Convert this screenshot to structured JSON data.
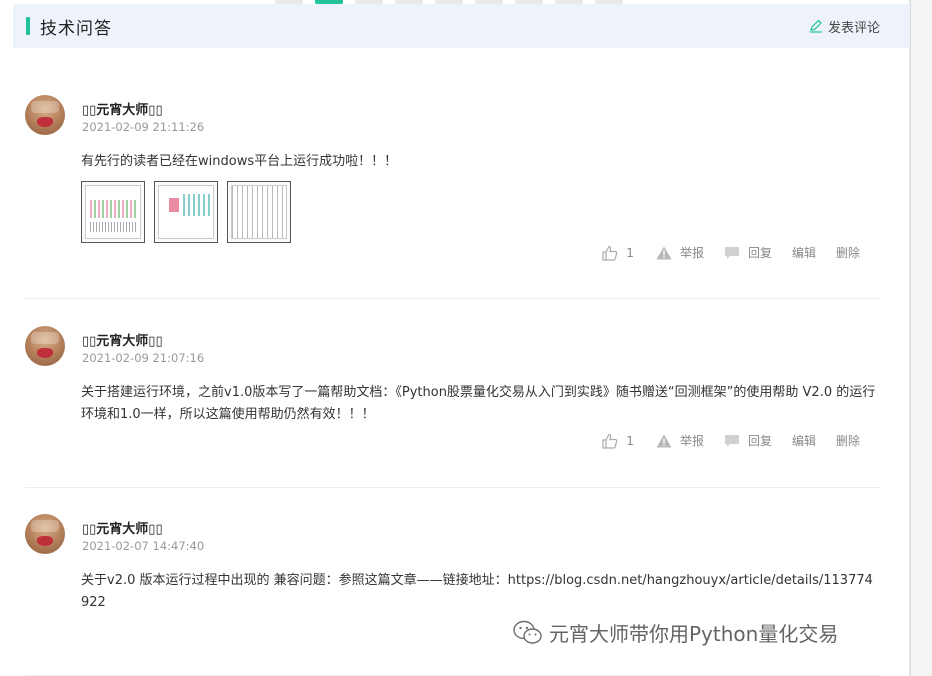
{
  "header": {
    "title": "技术问答",
    "post_label": "发表评论"
  },
  "comments": [
    {
      "username": "▯▯元宵大师▯▯",
      "time": "2021-02-09 21:11:26",
      "text": "有先行的读者已经在windows平台上运行成功啦！！！",
      "likes": "1",
      "report": "举报",
      "reply": "回复",
      "edit": "编辑",
      "delete": "删除"
    },
    {
      "username": "▯▯元宵大师▯▯",
      "time": "2021-02-09 21:07:16",
      "text": "关于搭建运行环境，之前v1.0版本写了一篇帮助文档：《Python股票量化交易从入门到实践》随书赠送“回测框架”的使用帮助 V2.0 的运行环境和1.0一样，所以这篇使用帮助仍然有效！！！",
      "likes": "1",
      "report": "举报",
      "reply": "回复",
      "edit": "编辑",
      "delete": "删除"
    },
    {
      "username": "▯▯元宵大师▯▯",
      "time": "2021-02-07 14:47:40",
      "text": "关于v2.0 版本运行过程中出现的 兼容问题：参照这篇文章——链接地址：https://blog.csdn.net/hangzhouyx/article/details/113774922"
    }
  ],
  "watermark": "元宵大师带你用Python量化交易",
  "colors": {
    "accent": "#22c39a",
    "header_bg": "#eef3fb"
  }
}
